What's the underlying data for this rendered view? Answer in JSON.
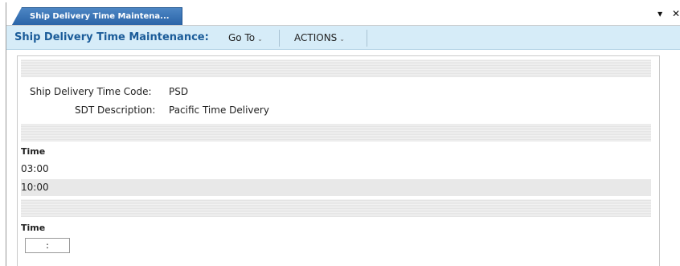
{
  "tab": {
    "label": "Ship Delivery Time Maintena..."
  },
  "window_controls": {
    "dropdown": "▾",
    "close": "✕"
  },
  "header": {
    "title": "Ship Delivery Time Maintenance:",
    "menus": [
      {
        "label": "Go To",
        "caret": "⌄"
      },
      {
        "label": "ACTIONS",
        "caret": "⌄"
      }
    ]
  },
  "form": {
    "code_label": "Ship Delivery Time Code:",
    "code_value": "PSD",
    "desc_label": "SDT Description:",
    "desc_value": "Pacific Time Delivery"
  },
  "times_table": {
    "header": "Time",
    "rows": [
      "03:00",
      "10:00"
    ]
  },
  "new_time": {
    "header": "Time",
    "value": ":"
  }
}
